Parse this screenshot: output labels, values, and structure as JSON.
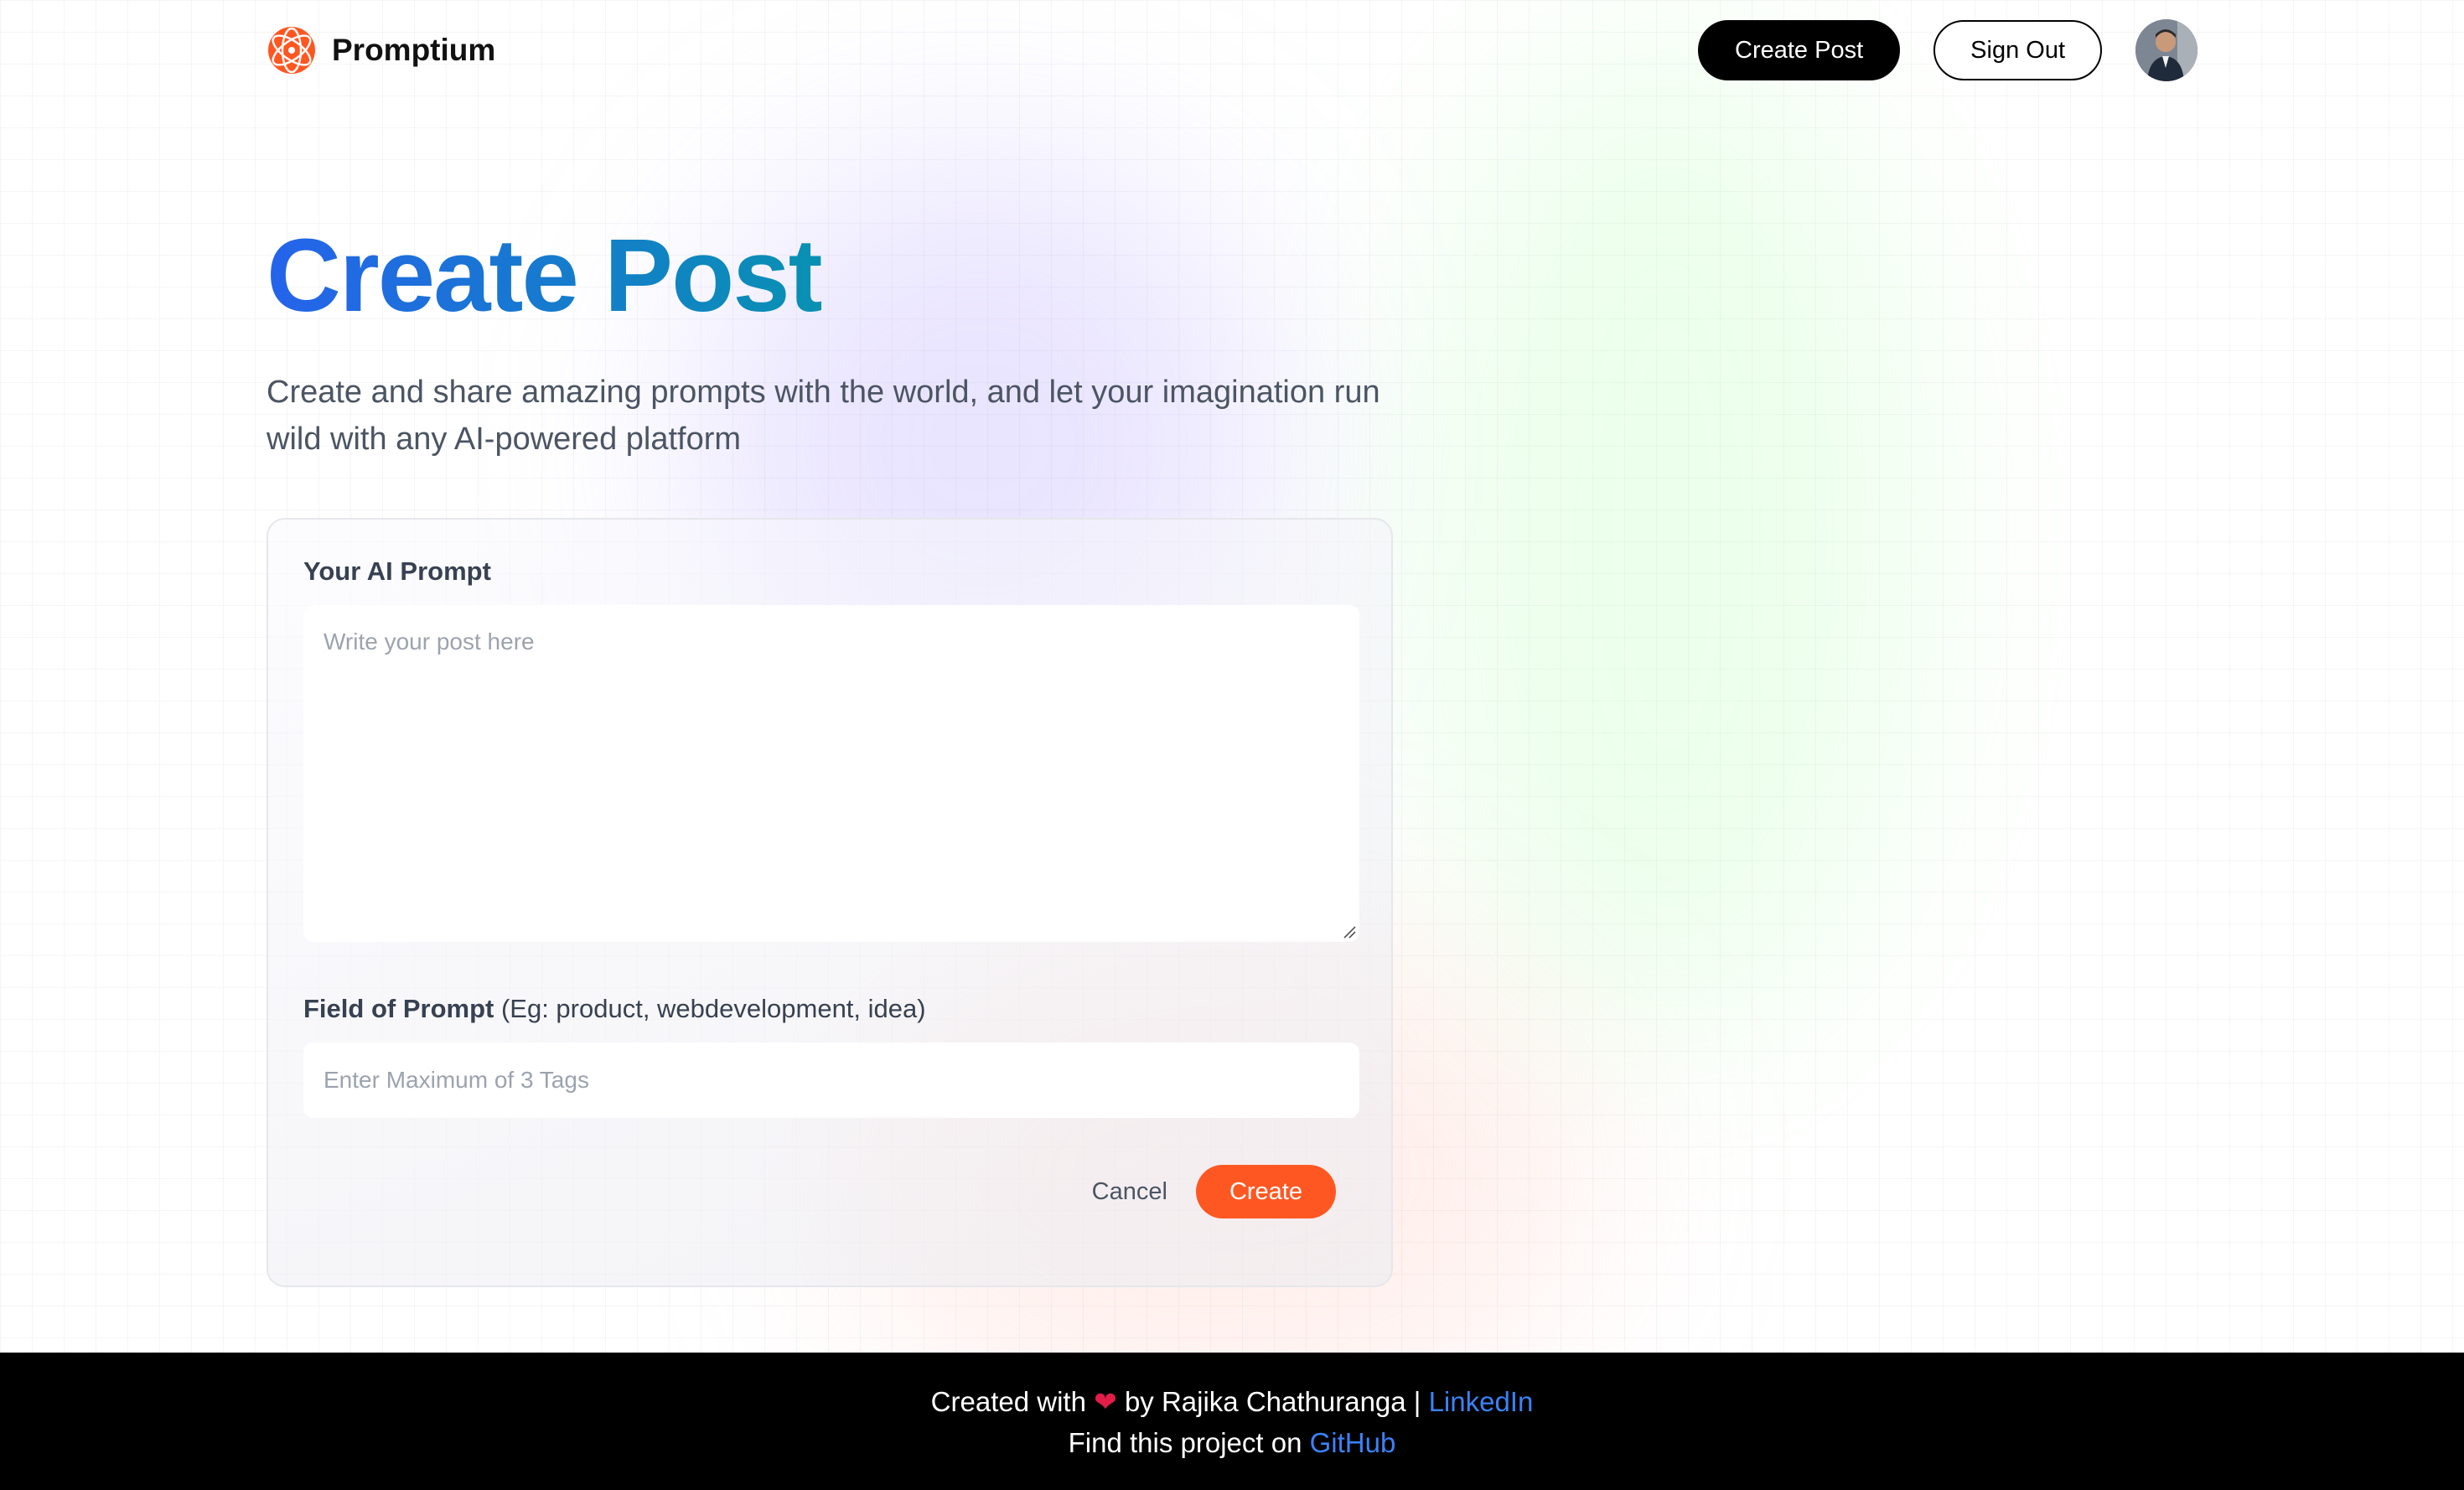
{
  "header": {
    "brand_name": "Promptium",
    "create_post_label": "Create Post",
    "sign_out_label": "Sign Out"
  },
  "main": {
    "title": "Create Post",
    "subtitle": "Create and share amazing prompts with the world, and let your imagination run wild with any AI-powered platform"
  },
  "form": {
    "prompt_label": "Your AI Prompt",
    "prompt_placeholder": "Write your post here",
    "tags_label": "Field of Prompt",
    "tags_hint": "(Eg: product, webdevelopment, idea)",
    "tags_placeholder": "Enter Maximum of 3 Tags",
    "cancel_label": "Cancel",
    "create_label": "Create"
  },
  "footer": {
    "line1_prefix": "Created with",
    "line1_by": "by Rajika Chathuranga |",
    "linkedin_label": "LinkedIn",
    "line2_prefix": "Find this project on",
    "github_label": "GitHub"
  },
  "colors": {
    "accent": "#ff5722",
    "title_gradient_start": "#2563eb",
    "title_gradient_end": "#0891b2",
    "link": "#3b82f6"
  },
  "icons": {
    "logo": "promptium-logo-icon",
    "heart": "heart-icon",
    "avatar": "user-avatar"
  }
}
